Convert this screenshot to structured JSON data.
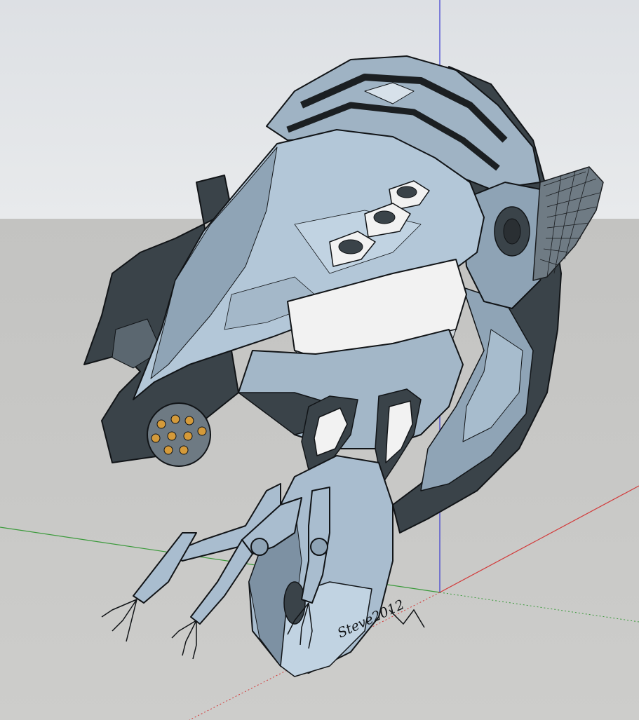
{
  "scene": {
    "sky_color": "#e2e4e7",
    "ground_color": "#c8c8c6",
    "axis_colors": {
      "red": "#d23a3a",
      "green": "#3a9a3a",
      "blue": "#3b3bd0"
    },
    "model_colors": {
      "hull_light": "#b3c7d8",
      "hull_mid": "#8fa4b6",
      "hull_dark": "#3a4349",
      "outline": "#111417",
      "vent": "#f2f2f2"
    }
  },
  "signature": {
    "text": "Steve2012"
  }
}
